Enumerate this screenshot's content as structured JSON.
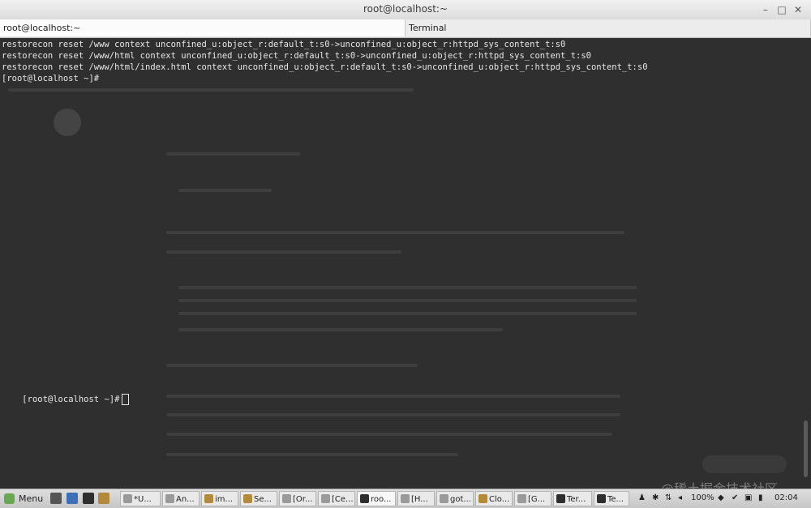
{
  "window": {
    "title": "root@localhost:~",
    "buttons": {
      "minimize": "–",
      "maximize": "□",
      "close": "✕"
    }
  },
  "tabs": [
    {
      "label": "root@localhost:~"
    },
    {
      "label": "Terminal"
    }
  ],
  "terminal": {
    "lines": [
      "restorecon reset /www context unconfined_u:object_r:default_t:s0->unconfined_u:object_r:httpd_sys_content_t:s0",
      "restorecon reset /www/html context unconfined_u:object_r:default_t:s0->unconfined_u:object_r:httpd_sys_content_t:s0",
      "restorecon reset /www/html/index.html context unconfined_u:object_r:default_t:s0->unconfined_u:object_r:httpd_sys_content_t:s0",
      "[root@localhost ~]#"
    ],
    "prompt": "[root@localhost ~]#"
  },
  "taskbar": {
    "menu_label": "Menu",
    "tasks": [
      {
        "label": "*U..."
      },
      {
        "label": "An..."
      },
      {
        "label": "im..."
      },
      {
        "label": "Se..."
      },
      {
        "label": "[Or..."
      },
      {
        "label": "[Ce..."
      },
      {
        "label": "roo..."
      },
      {
        "label": "[H..."
      },
      {
        "label": "got..."
      },
      {
        "label": "Clo..."
      },
      {
        "label": "[G..."
      },
      {
        "label": "Ter..."
      },
      {
        "label": "Te..."
      }
    ],
    "battery": "100%",
    "clock": "02:04"
  },
  "watermark": "@稀土掘金技术社区",
  "colors": {
    "terminal_bg": "#2f2f2f",
    "terminal_fg": "#e6e6e6",
    "menu_icon": "#6aa84f"
  }
}
